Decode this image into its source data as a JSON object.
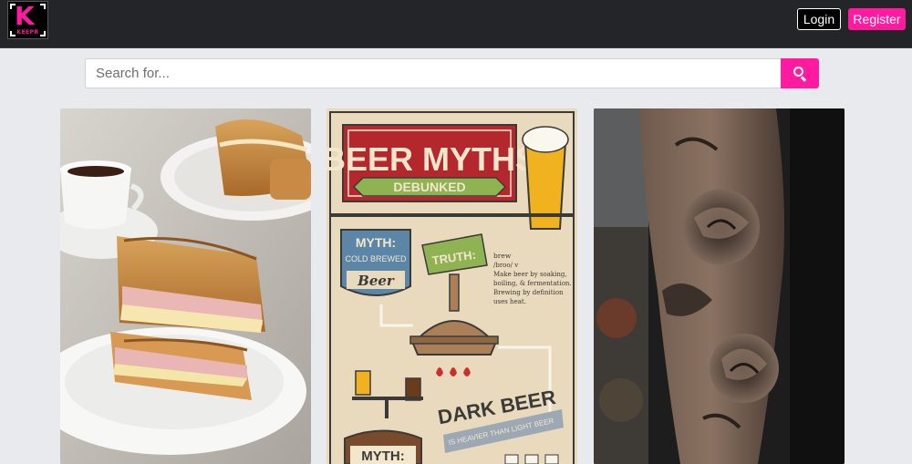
{
  "navbar": {
    "logo_letter": "K",
    "logo_word": "KEEPR",
    "login_label": "Login",
    "register_label": "Register"
  },
  "search": {
    "placeholder": "Search for...",
    "value": "",
    "button_icon": "search-icon"
  },
  "cards": [
    {
      "subject": "grilled ham and cheese sandwich"
    },
    {
      "subject": "beer myths infographic",
      "title_line1": "BEER MYTHS",
      "title_ribbon": "DEBUNKED",
      "myth1_label": "MYTH:",
      "myth1_text1": "COLD BREWED",
      "myth1_text2": "Beer",
      "truth_label": "TRUTH:",
      "truth_word": "brew",
      "truth_pron": "/broo/ v",
      "truth_def1": "Make beer by soaking,",
      "truth_def2": "boiling, & fermentation.",
      "truth_def3": "Brewing by definition",
      "truth_def4": "uses heat.",
      "dark_beer": "DARK BEER",
      "dark_beer_sub": "IS HEAVIER THAN LIGHT BEER",
      "myth2_label": "MYTH:"
    },
    {
      "subject": "rose sleeve tattoo"
    }
  ],
  "colors": {
    "accent": "#ff1aa0",
    "navbar_bg": "#242528",
    "page_bg": "#e9eaee"
  }
}
